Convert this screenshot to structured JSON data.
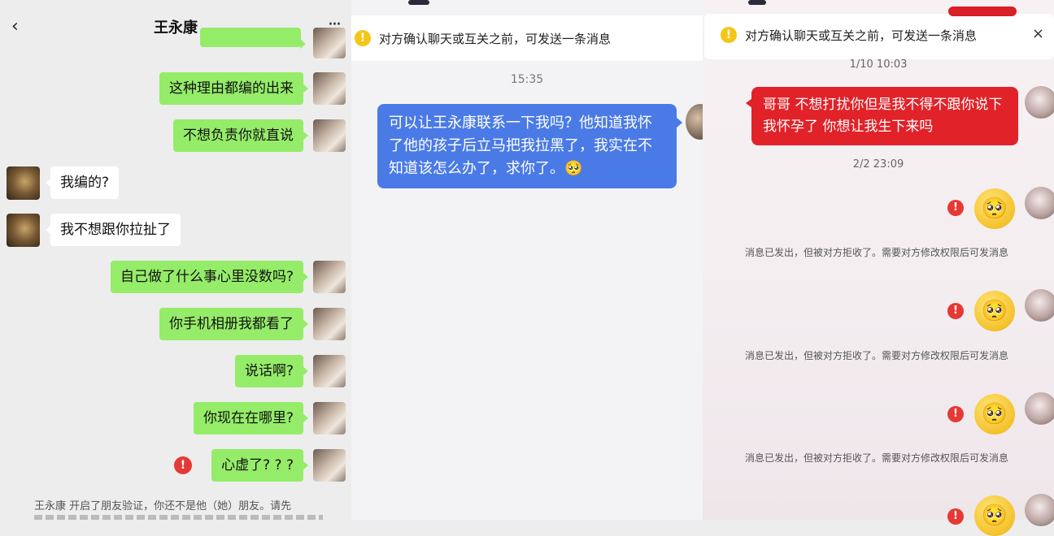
{
  "panel1": {
    "title": "王永康",
    "back_icon": "‹",
    "more_icon": "···",
    "messages": [
      {
        "side": "right",
        "text": "这种理由都编的出来"
      },
      {
        "side": "right",
        "text": "不想负责你就直说"
      },
      {
        "side": "left",
        "text": "我编的?"
      },
      {
        "side": "left",
        "text": "我不想跟你拉扯了"
      },
      {
        "side": "right",
        "text": "自己做了什么事心里没数吗?"
      },
      {
        "side": "right",
        "text": "你手机相册我都看了"
      },
      {
        "side": "right",
        "text": "说话啊?"
      },
      {
        "side": "right",
        "text": "你现在在哪里?"
      },
      {
        "side": "right",
        "text": "心虚了? ? ?",
        "failed": true
      }
    ],
    "error_glyph": "!",
    "bottom_note": "王永康 开启了朋友验证，你还不是他（她）朋友。请先"
  },
  "panel2": {
    "notice": "对方确认聊天或互关之前，可发送一条消息",
    "notice_icon": "!",
    "time": "15:35",
    "message": "可以让王永康联系一下我吗？他知道我怀了他的孩子后立马把我拉黑了，我实在不知道该怎么办了，求你了。",
    "message_emoji": "🥺"
  },
  "panel3": {
    "notice": "对方确认聊天或互关之前，可发送一条消息",
    "notice_icon": "!",
    "close_icon": "×",
    "time1": "1/10 10:03",
    "message": "哥哥 不想打扰你但是我不得不跟你说下 我怀孕了 你想让我生下来吗",
    "time2": "2/2 23:09",
    "emoji": "🥺",
    "error_glyph": "!",
    "rejected_text": "消息已发出，但被对方拒收了。需要对方修改权限后可发消息"
  },
  "colors": {
    "wechat_green": "#95ec69",
    "blue_bubble": "#4a7ae6",
    "red_bubble": "#e12228",
    "error_red": "#e53935",
    "warning_yellow": "#f5c518"
  }
}
